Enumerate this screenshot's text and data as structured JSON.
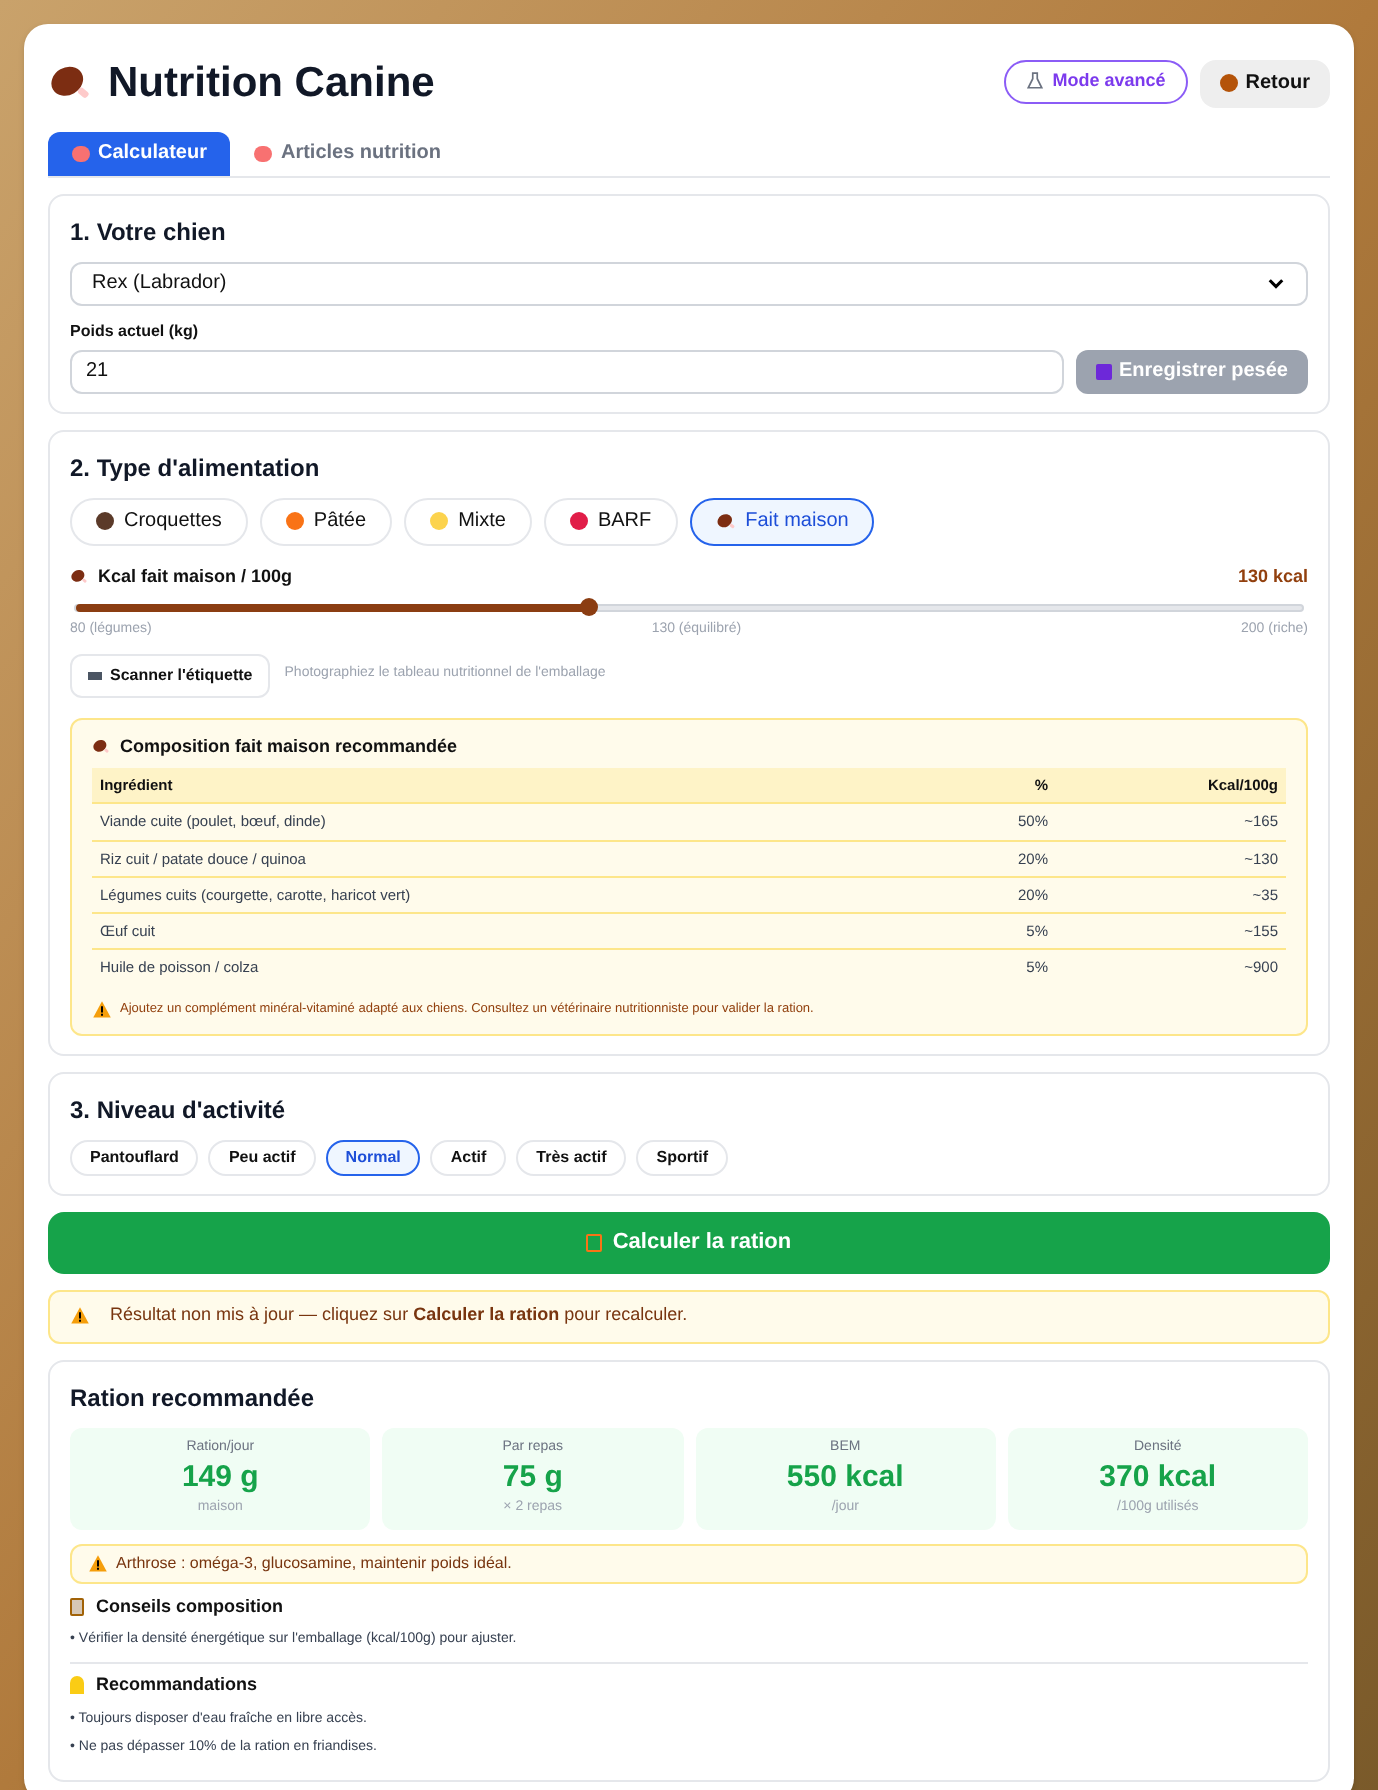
{
  "header": {
    "title": "Nutrition Canine",
    "buttons": [
      {
        "label": "Mode avancé",
        "kind": "advanced"
      },
      {
        "label": "Retour",
        "kind": "back"
      }
    ]
  },
  "tabs": [
    {
      "label": "Calculateur",
      "selected": true
    },
    {
      "label": "Articles nutrition",
      "selected": false
    }
  ],
  "dog_section": {
    "title": "1. Votre chien",
    "dog_select": "Rex (Labrador)",
    "weight_label": "Poids actuel (kg)",
    "weight_value": "21",
    "save_button": {
      "label": "Enregistrer pesée",
      "disabled": true
    }
  },
  "food_section": {
    "title": "2. Type d'alimentation",
    "options": [
      {
        "label": "Croquettes",
        "selected": false
      },
      {
        "label": "Pâtée",
        "selected": false
      },
      {
        "label": "Mixte",
        "selected": false
      },
      {
        "label": "BARF",
        "selected": false
      },
      {
        "label": "Fait maison",
        "selected": true
      }
    ],
    "slider": {
      "label": "Kcal fait maison / 100g",
      "reading": "130 kcal",
      "level": 0.417,
      "ticks": [
        "80 (légumes)",
        "130 (équilibré)",
        "200 (riche)"
      ]
    },
    "scan_button": "Scanner l'étiquette",
    "scan_hint": "Photographiez le tableau nutritionnel de l'emballage",
    "composition": {
      "title": "Composition fait maison recommandée",
      "columns": [
        "Ingrédient",
        "%",
        "Kcal/100g"
      ],
      "rows": [
        [
          "Viande cuite (poulet, bœuf, dinde)",
          "50%",
          "~165"
        ],
        [
          "Riz cuit / patate douce / quinoa",
          "20%",
          "~130"
        ],
        [
          "Légumes cuits (courgette, carotte, haricot vert)",
          "20%",
          "~35"
        ],
        [
          "Œuf cuit",
          "5%",
          "~155"
        ],
        [
          "Huile de poisson / colza",
          "5%",
          "~900"
        ]
      ],
      "note": "Ajoutez un complément minéral-vitaminé adapté aux chiens. Consultez un vétérinaire nutritionniste pour valider la ration."
    }
  },
  "activity_section": {
    "title": "3. Niveau d'activité",
    "options": [
      {
        "label": "Pantouflard",
        "selected": false
      },
      {
        "label": "Peu actif",
        "selected": false
      },
      {
        "label": "Normal",
        "selected": true
      },
      {
        "label": "Actif",
        "selected": false
      },
      {
        "label": "Très actif",
        "selected": false
      },
      {
        "label": "Sportif",
        "selected": false
      }
    ]
  },
  "calculate_button": "Calculer la ration",
  "stale_alert": "Résultat non mis à jour — cliquez sur **Calculer la ration** pour recalculer.",
  "result": {
    "title": "Ration recommandée",
    "stats": [
      {
        "label": "Ration/jour",
        "value": "149 g",
        "sub": "maison"
      },
      {
        "label": "Par repas",
        "value": "75 g",
        "sub": "× 2 repas"
      },
      {
        "label": "BEM",
        "value": "550 kcal",
        "sub": "/jour"
      },
      {
        "label": "Densité",
        "value": "370 kcal",
        "sub": "/100g utilisés"
      }
    ],
    "alert": "Arthrose : oméga-3, glucosamine, maintenir poids idéal.",
    "sections": [
      {
        "title": "Conseils composition",
        "kind": "advice",
        "items": [
          "• Vérifier la densité énergétique sur l'emballage (kcal/100g) pour ajuster."
        ]
      },
      {
        "title": "Recommandations",
        "kind": "tips",
        "items": [
          "• Toujours disposer d'eau fraîche en libre accès.",
          "• Ne pas dépasser 10% de la ration en friandises."
        ]
      }
    ]
  }
}
